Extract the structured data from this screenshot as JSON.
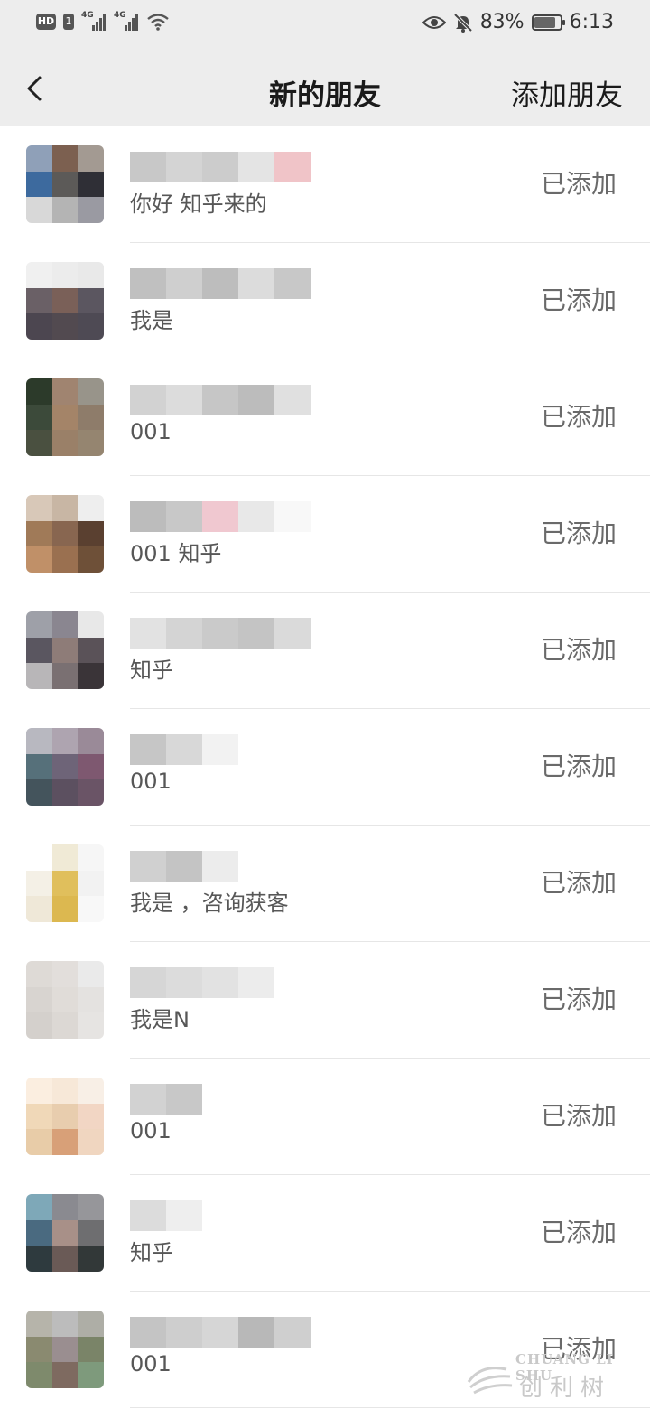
{
  "status_bar": {
    "hd_label": "HD",
    "sim_label": "1",
    "net1": "4G",
    "net2": "4G",
    "battery_percent": "83%",
    "battery_level": 0.83,
    "time": "6:13"
  },
  "nav": {
    "title": "新的朋友",
    "add_friend_label": "添加朋友"
  },
  "rows": [
    {
      "subtitle": "你好 知乎来的",
      "status": "已添加",
      "colors": [
        "#8fa0b8",
        "#7c6050",
        "#a39a92",
        "#3d6a9e",
        "#5c5a58",
        "#2f2f36",
        "#d8d8d8",
        "#b4b4b4",
        "#9a9aa2"
      ]
    },
    {
      "subtitle": "我是",
      "status": "已添加",
      "colors": [
        "#f0f0f0",
        "#ececec",
        "#e9e9e9",
        "#6a6066",
        "#7a6058",
        "#5b5660",
        "#4c4650",
        "#524a50",
        "#4e4a54"
      ]
    },
    {
      "subtitle": "001",
      "status": "已添加",
      "colors": [
        "#2c3a2a",
        "#a08470",
        "#98948a",
        "#3c4a3a",
        "#a48468",
        "#8e7c6a",
        "#4a5040",
        "#9a8068",
        "#958570"
      ]
    },
    {
      "subtitle": "001 知乎",
      "status": "已添加",
      "colors": [
        "#d8c8b8",
        "#c8b6a4",
        "#eee",
        "#a07a58",
        "#886650",
        "#5a4030",
        "#c09068",
        "#9a7050",
        "#6e5038"
      ]
    },
    {
      "subtitle": "知乎",
      "status": "已添加",
      "colors": [
        "#9ea0a8",
        "#8a8690",
        "#e8e8e8",
        "#5a5660",
        "#8e7c78",
        "#5a5258",
        "#b8b6b8",
        "#7a7072",
        "#3a3438"
      ]
    },
    {
      "subtitle": "001",
      "status": "已添加",
      "colors": [
        "#b8b8c0",
        "#aea4b0",
        "#9a8a98",
        "#56707a",
        "#6e6478",
        "#7e5870",
        "#44545c",
        "#5c5060",
        "#6a5466"
      ]
    },
    {
      "subtitle": "我是 ，咨询获客",
      "status": "已添加",
      "colors": [
        "#ffffff",
        "#f0ead6",
        "#f6f6f6",
        "#f4f0e6",
        "#e0bf5c",
        "#f2f2f2",
        "#efe8d8",
        "#dcb850",
        "#f8f8f8"
      ]
    },
    {
      "subtitle": "我是N",
      "status": "已添加",
      "colors": [
        "#dedad6",
        "#e2dedb",
        "#eaeaea",
        "#d8d4d0",
        "#e0dcd8",
        "#e4e2e0",
        "#d4d0cc",
        "#dcd8d4",
        "#e6e4e2"
      ]
    },
    {
      "subtitle": "001",
      "status": "已添加",
      "colors": [
        "#fbeee0",
        "#f7e8d8",
        "#f8efe6",
        "#f0d8b8",
        "#e8cdae",
        "#f2d6c4",
        "#e8cca8",
        "#d8a078",
        "#f0d6c0"
      ]
    },
    {
      "subtitle": "知乎",
      "status": "已添加",
      "colors": [
        "#7ea8b8",
        "#8a8a90",
        "#96969a",
        "#4a6a80",
        "#a89088",
        "#6e6e70",
        "#2e3a3e",
        "#6a5a56",
        "#323838"
      ]
    },
    {
      "subtitle": "001",
      "status": "已添加",
      "colors": [
        "#b6b4aa",
        "#bcbcbc",
        "#aeaea6",
        "#8a8a70",
        "#9a8e90",
        "#7a8468",
        "#7e8a6c",
        "#7e6a60",
        "#7e9a7c"
      ]
    }
  ],
  "watermark": {
    "line1": "CHUANG LI SHU",
    "line2": "创利树"
  }
}
